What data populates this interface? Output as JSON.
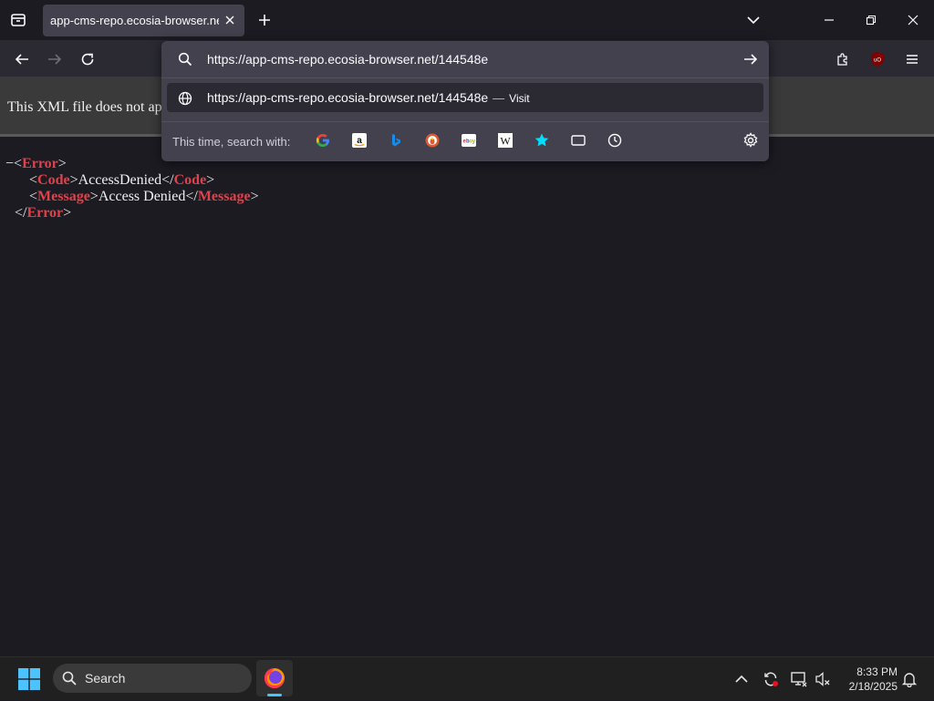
{
  "tab": {
    "title": "app-cms-repo.ecosia-browser.net/"
  },
  "urlbar": {
    "value": "https://app-cms-repo.ecosia-browser.net/144548e",
    "suggestion_url": "https://app-cms-repo.ecosia-browser.net/144548e",
    "suggestion_separator": "—",
    "suggestion_action": "Visit",
    "search_with_label": "This time, search with:",
    "engines": [
      "google-icon",
      "amazon-icon",
      "bing-icon",
      "duckduckgo-icon",
      "ebay-icon",
      "wikipedia-icon",
      "bookmarks-icon",
      "tabs-icon",
      "history-icon"
    ]
  },
  "page": {
    "banner_text": "This XML file does not ap",
    "collapse_marker": "−",
    "lt": "<",
    "gt": ">",
    "lt_slash": "</",
    "root_tag": "Error",
    "code_tag": "Code",
    "code_value": "AccessDenied",
    "message_tag": "Message",
    "message_value": "Access Denied"
  },
  "taskbar": {
    "search_placeholder": "Search",
    "time": "8:33 PM",
    "date": "2/18/2025"
  },
  "colors": {
    "accent": "#4cc2ff",
    "xml_tag": "#e0414b",
    "ublock": "#800000"
  }
}
